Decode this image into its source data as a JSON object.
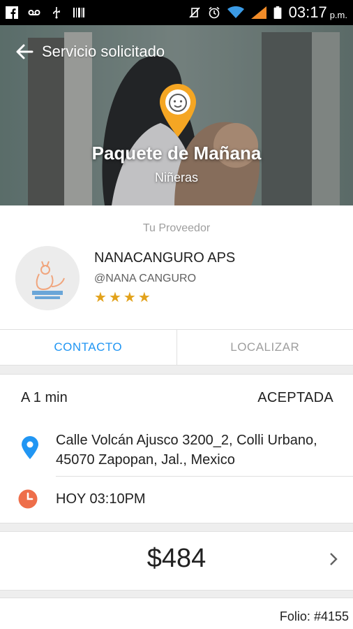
{
  "status_bar": {
    "time": "03:17",
    "ampm": "p.m."
  },
  "header": {
    "title": "Servicio solicitado"
  },
  "hero": {
    "title": "Paquete de Mañana",
    "subtitle": "Niñeras"
  },
  "provider": {
    "section_label": "Tu Proveedor",
    "name": "NANACANGURO APS",
    "handle": "@NANA CANGURO",
    "rating_stars": 4
  },
  "tabs": {
    "contact": "CONTACTO",
    "locate": "LOCALIZAR"
  },
  "status": {
    "eta": "A 1 min",
    "state": "ACEPTADA"
  },
  "address": "Calle Volcán Ajusco 3200_2, Colli Urbano, 45070 Zapopan, Jal., Mexico",
  "schedule": "HOY 03:10PM",
  "price": "$484",
  "folio": "Folio: #4155",
  "colors": {
    "accent": "#2196f3",
    "pin": "#f5a623",
    "star": "#e2a21b",
    "clock": "#ee6e4a"
  }
}
